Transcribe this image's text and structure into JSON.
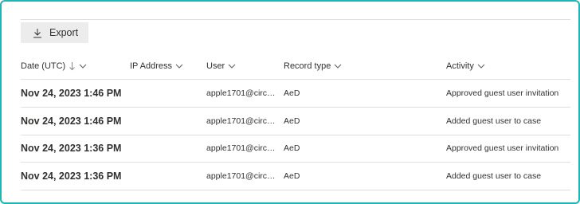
{
  "toolbar": {
    "export_label": "Export"
  },
  "columns": {
    "date": "Date (UTC)",
    "ip": "IP Address",
    "user": "User",
    "record_type": "Record type",
    "activity": "Activity"
  },
  "rows": [
    {
      "date": "Nov 24, 2023 1:46 PM",
      "ip": "",
      "user": "apple1701@circus...",
      "record_type": "AeD",
      "activity": "Approved guest user invitation"
    },
    {
      "date": "Nov 24, 2023 1:46 PM",
      "ip": "",
      "user": "apple1701@circus...",
      "record_type": "AeD",
      "activity": "Added guest user to case"
    },
    {
      "date": "Nov 24, 2023 1:36 PM",
      "ip": "",
      "user": "apple1701@circus...",
      "record_type": "AeD",
      "activity": "Approved guest user invitation"
    },
    {
      "date": "Nov 24, 2023 1:36 PM",
      "ip": "",
      "user": "apple1701@circus...",
      "record_type": "AeD",
      "activity": "Added guest user to case"
    }
  ],
  "colors": {
    "frame_border": "#20b4b4",
    "button_bg": "#ececec",
    "divider": "#e1dfdd"
  },
  "icons": {
    "export": "download-icon",
    "sort": "arrow-down-icon",
    "dropdown": "chevron-down-icon"
  }
}
